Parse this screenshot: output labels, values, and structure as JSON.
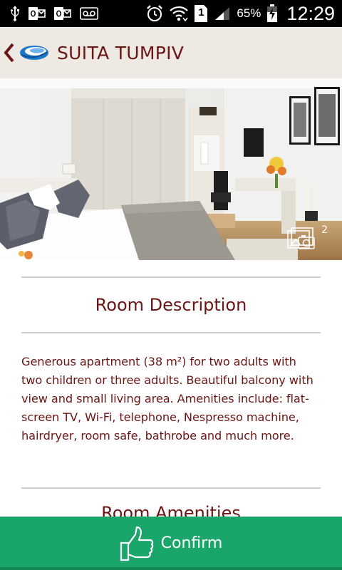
{
  "status_bar": {
    "icons": [
      "usb-icon",
      "outlook-icon",
      "outlook-icon",
      "voicemail-icon",
      "alarm-icon",
      "wifi-icon",
      "sim-icon",
      "signal-icon",
      "battery-charging-icon"
    ],
    "sim_slot": "1",
    "battery_percent": "65%",
    "time": "12:29"
  },
  "header": {
    "title": "SUITA TUMPIV",
    "back_icon": "chevron-left-icon",
    "logo_icon": "hotel-logo-icon"
  },
  "photo": {
    "gallery_icon": "photo-gallery-icon",
    "count": "2"
  },
  "description_section": {
    "heading": "Room Description",
    "text": "Generous apartment (38 m²) for two adults with two children or three adults. Beautiful balcony with view and small living area. Amenities include: flat-screen TV, Wi-Fi, telephone, Nespresso machine, hairdryer, room safe, bathrobe and much more."
  },
  "amenities_section": {
    "heading": "Room Amenities"
  },
  "confirm": {
    "label": "Confirm",
    "icon": "thumbs-up-icon"
  },
  "colors": {
    "status_bar": "#000000",
    "header_bg": "#eee9e3",
    "accent_text": "#6b1515",
    "confirm_bg": "#1aa56a",
    "divider": "#cfcfcf"
  }
}
